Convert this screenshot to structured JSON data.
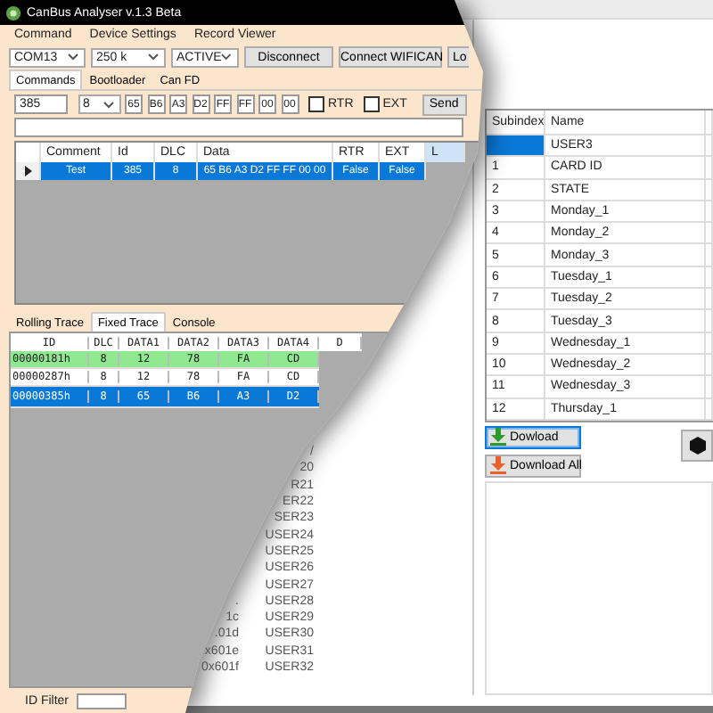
{
  "back_window": {
    "list_fragments": [
      {
        "name": "/"
      },
      {
        "name": "20"
      },
      {
        "name": "R21"
      },
      {
        "name": "ER22"
      },
      {
        "name": "SER23"
      },
      {
        "name": "USER24"
      },
      {
        "name": "USER25"
      },
      {
        "name": "USER26"
      },
      {
        "name": "USER27"
      },
      {
        "index": ".",
        "name": "USER28"
      },
      {
        "index": "1c",
        "name": "USER29"
      },
      {
        "index": ".01d",
        "name": "USER30"
      },
      {
        "index": "x601e",
        "name": "USER31"
      },
      {
        "index": "0x601f",
        "name": "USER32"
      }
    ],
    "table": {
      "columns": [
        "Subindex",
        "Name"
      ],
      "rows": [
        {
          "subindex": "",
          "name": "USER3",
          "selected": true
        },
        {
          "subindex": "1",
          "name": "CARD ID",
          "selected": false
        },
        {
          "subindex": "2",
          "name": "STATE",
          "selected": false
        },
        {
          "subindex": "3",
          "name": "Monday_1",
          "selected": false
        },
        {
          "subindex": "4",
          "name": "Monday_2",
          "selected": false
        },
        {
          "subindex": "5",
          "name": "Monday_3",
          "selected": false
        },
        {
          "subindex": "6",
          "name": "Tuesday_1",
          "selected": false
        },
        {
          "subindex": "7",
          "name": "Tuesday_2",
          "selected": false
        },
        {
          "subindex": "8",
          "name": "Tuesday_3",
          "selected": false
        },
        {
          "subindex": "9",
          "name": "Wednesday_1",
          "selected": false
        },
        {
          "subindex": "10",
          "name": "Wednesday_2",
          "selected": false
        },
        {
          "subindex": "11",
          "name": "Wednesday_3",
          "selected": false
        },
        {
          "subindex": "12",
          "name": "Thursday_1",
          "selected": false
        }
      ]
    },
    "buttons": [
      {
        "label": "Dowload",
        "color": "#2e9a2e",
        "focused": true
      },
      {
        "label": "Download All",
        "color": "#e8602c",
        "focused": false
      }
    ]
  },
  "window": {
    "title": "CanBus Analyser v.1.3 Beta"
  },
  "menu": [
    "Command",
    "Device Settings",
    "Record Viewer"
  ],
  "toolbar": {
    "port": "COM13",
    "baud": "250 k",
    "mode": "ACTIVE",
    "buttons": [
      "Disconnect",
      "Connect WIFICAN",
      "Lo"
    ]
  },
  "tabs": [
    {
      "label": "Commands",
      "selected": true
    },
    {
      "label": "Bootloader",
      "selected": false
    },
    {
      "label": "Can FD",
      "selected": false
    }
  ],
  "message": {
    "id": "385",
    "dlc": "8",
    "bytes": [
      "65",
      "B6",
      "A3",
      "D2",
      "FF",
      "FF",
      "00",
      "00"
    ],
    "options": [
      {
        "label": "RTR",
        "checked": false
      },
      {
        "label": "EXT",
        "checked": false
      }
    ],
    "send": "Send"
  },
  "commands_table": {
    "columns": [
      "Comment",
      "Id",
      "DLC",
      "Data",
      "RTR",
      "EXT",
      "L"
    ],
    "rows": [
      {
        "cells": [
          "Test",
          "385",
          "8",
          "65 B6 A3 D2 FF FF 00 00",
          "False",
          "False"
        ],
        "selected": true
      }
    ]
  },
  "trace_tabs": [
    {
      "label": "Rolling Trace",
      "selected": false
    },
    {
      "label": "Fixed Trace",
      "selected": true
    },
    {
      "label": "Console",
      "selected": false
    }
  ],
  "trace": {
    "columns": [
      "ID",
      "DLC",
      "DATA1",
      "DATA2",
      "DATA3",
      "DATA4",
      "D"
    ],
    "rows": [
      {
        "cells": [
          "00000181h",
          "8",
          "12",
          "78",
          "FA",
          "CD"
        ],
        "highlighted": true,
        "selected": false
      },
      {
        "cells": [
          "00000287h",
          "8",
          "12",
          "78",
          "FA",
          "CD"
        ],
        "highlighted": false,
        "selected": false
      },
      {
        "cells": [
          "00000385h",
          "8",
          "65",
          "B6",
          "A3",
          "D2"
        ],
        "highlighted": false,
        "selected": true
      }
    ]
  },
  "id_filter": {
    "label": "ID Filter"
  }
}
